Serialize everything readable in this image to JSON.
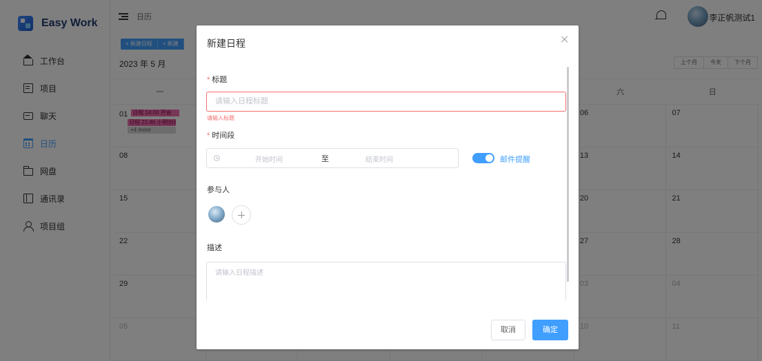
{
  "app": {
    "name": "Easy Work"
  },
  "sidebar": {
    "items": [
      {
        "label": "工作台",
        "icon": "home-icon"
      },
      {
        "label": "项目",
        "icon": "document-icon"
      },
      {
        "label": "聊天",
        "icon": "chat-icon"
      },
      {
        "label": "日历",
        "icon": "calendar-icon",
        "active": true
      },
      {
        "label": "网盘",
        "icon": "folder-icon"
      },
      {
        "label": "通讯录",
        "icon": "contacts-icon"
      },
      {
        "label": "项目组",
        "icon": "user-icon"
      }
    ]
  },
  "header": {
    "breadcrumb": "日历",
    "username": "李正帆测试1"
  },
  "calendar": {
    "buttons": [
      "+ 新建日程",
      "+ 新建"
    ],
    "month_title": "2023 年 5 月",
    "nav": [
      "上个月",
      "今天",
      "下个月"
    ],
    "weekdays": [
      "一",
      "",
      "",
      "",
      "",
      "六",
      "日"
    ],
    "rows": [
      [
        "01",
        "",
        "",
        "",
        "",
        "06",
        "07"
      ],
      [
        "08",
        "",
        "",
        "",
        "",
        "13",
        "14"
      ],
      [
        "15",
        "",
        "",
        "",
        "",
        "20",
        "21"
      ],
      [
        "22",
        "",
        "",
        "",
        "",
        "27",
        "28"
      ],
      [
        "29",
        "",
        "",
        "",
        "",
        "03",
        "04"
      ],
      [
        "05",
        "",
        "",
        "",
        "",
        "10",
        "11"
      ]
    ],
    "events": [
      "日程 14:00 开会",
      "日程 21:46 小明创建",
      "+4 more"
    ]
  },
  "dialog": {
    "title": "新建日程",
    "title_label": "标题",
    "title_placeholder": "请输入日程标题",
    "title_error": "请输入标题",
    "time_label": "时间段",
    "start_placeholder": "开始时间",
    "range_separator": "至",
    "end_placeholder": "结束时间",
    "email_reminder_label": "邮件提醒",
    "email_reminder_on": true,
    "participants_label": "参与人",
    "description_label": "描述",
    "description_placeholder": "请输入日程描述",
    "cancel_label": "取消",
    "confirm_label": "确定"
  },
  "colors": {
    "primary": "#409eff",
    "danger": "#f56c6c",
    "event": "#f26fb0"
  }
}
